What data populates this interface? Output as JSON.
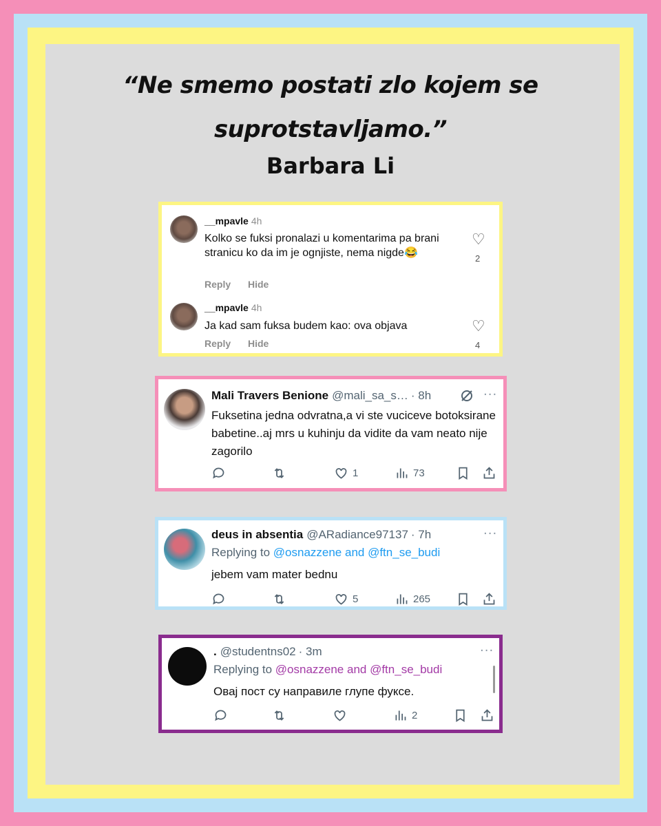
{
  "quote": {
    "line1": "“Ne smemo postati zlo kojem se",
    "line2": "suprotstavljamo.”",
    "author": "Barbara Li"
  },
  "instagram_comments": [
    {
      "username": "__mpavle",
      "time": "4h",
      "text": "Kolko se fuksi pronalazi u komentarima pa brani stranicu ko da im je ognjiste, nema nigde😂",
      "reply_label": "Reply",
      "hide_label": "Hide",
      "likes": "2"
    },
    {
      "username": "__mpavle",
      "time": "4h",
      "text": "Ja kad sam fuksa budem kao: ova objava",
      "reply_label": "Reply",
      "hide_label": "Hide",
      "likes": "4"
    }
  ],
  "tweets": [
    {
      "name": "Mali Travers Benione",
      "handle": "@mali_sa_s…",
      "time": "· 8h",
      "text": "Fuksetina jedna odvratna,a vi ste vuciceve botoksirane babetine..aj mrs u kuhinju da vidite da vam neato nije zagorilo",
      "likes": "1",
      "views": "73"
    },
    {
      "name": "deus in absentia",
      "handle": "@ARadiance97137",
      "time": "· 7h",
      "replying_prefix": "Replying to ",
      "replying_to": "@osnazzene and @ftn_se_budi",
      "text": "jebem vam mater bednu",
      "likes": "5",
      "views": "265"
    },
    {
      "name": ".",
      "handle": "@studentns02",
      "time": "· 3m",
      "replying_prefix": "Replying to ",
      "replying_to": "@osnazzene and @ftn_se_budi",
      "text": "Овај пост су направиле глупе фуксе.",
      "likes": "",
      "views": "2"
    }
  ],
  "icons": {
    "more": "···",
    "heart_outline": "♡"
  },
  "colors": {
    "frame_pink": "#f58fb8",
    "frame_blue": "#b9e1f6",
    "frame_yellow": "#fdf583",
    "frame_purple": "#8a2c8e",
    "twitter_blue": "#1d9bf0"
  }
}
